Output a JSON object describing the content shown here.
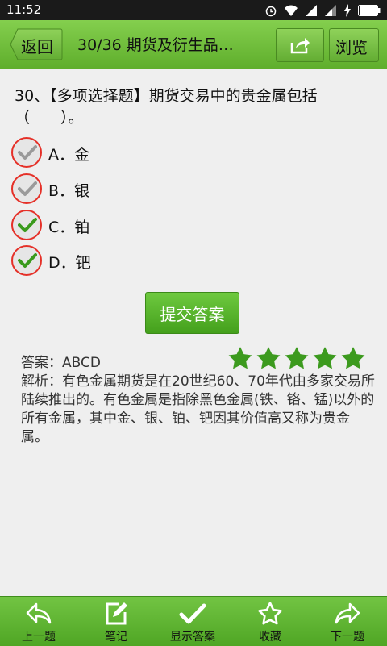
{
  "status_bar": {
    "time": "11:52"
  },
  "toolbar": {
    "back_label": "返回",
    "title": "30/36 期货及衍生品…",
    "browse_label": "浏览"
  },
  "question": {
    "text": "30、【多项选择题】期货交易中的贵金属包括（　　）。",
    "options": [
      {
        "letter": "A",
        "text": "A．金",
        "checked": false
      },
      {
        "letter": "B",
        "text": "B．银",
        "checked": false
      },
      {
        "letter": "C",
        "text": "C．铂",
        "checked": true
      },
      {
        "letter": "D",
        "text": "D．钯",
        "checked": true
      }
    ]
  },
  "submit_label": "提交答案",
  "answer": {
    "text": "答案：ABCD",
    "stars": 5
  },
  "analysis": "解析：有色金属期货是在20世纪60、70年代由多家交易所陆续推出的。有色金属是指除黑色金属(铁、铬、锰)以外的所有金属，其中金、银、铂、钯因其价值高又称为贵金属。",
  "bottom_nav": [
    {
      "label": "上一题",
      "icon": "back-arrow-icon"
    },
    {
      "label": "笔记",
      "icon": "note-edit-icon"
    },
    {
      "label": "显示答案",
      "icon": "checkmark-icon"
    },
    {
      "label": "收藏",
      "icon": "star-outline-icon"
    },
    {
      "label": "下一题",
      "icon": "forward-arrow-icon"
    }
  ],
  "colors": {
    "accent": "#5fae2c",
    "check_gray": "#9a9a9a",
    "check_green": "#3a9a1c",
    "circle_red": "#e53028",
    "star_green": "#3c9a1e"
  }
}
